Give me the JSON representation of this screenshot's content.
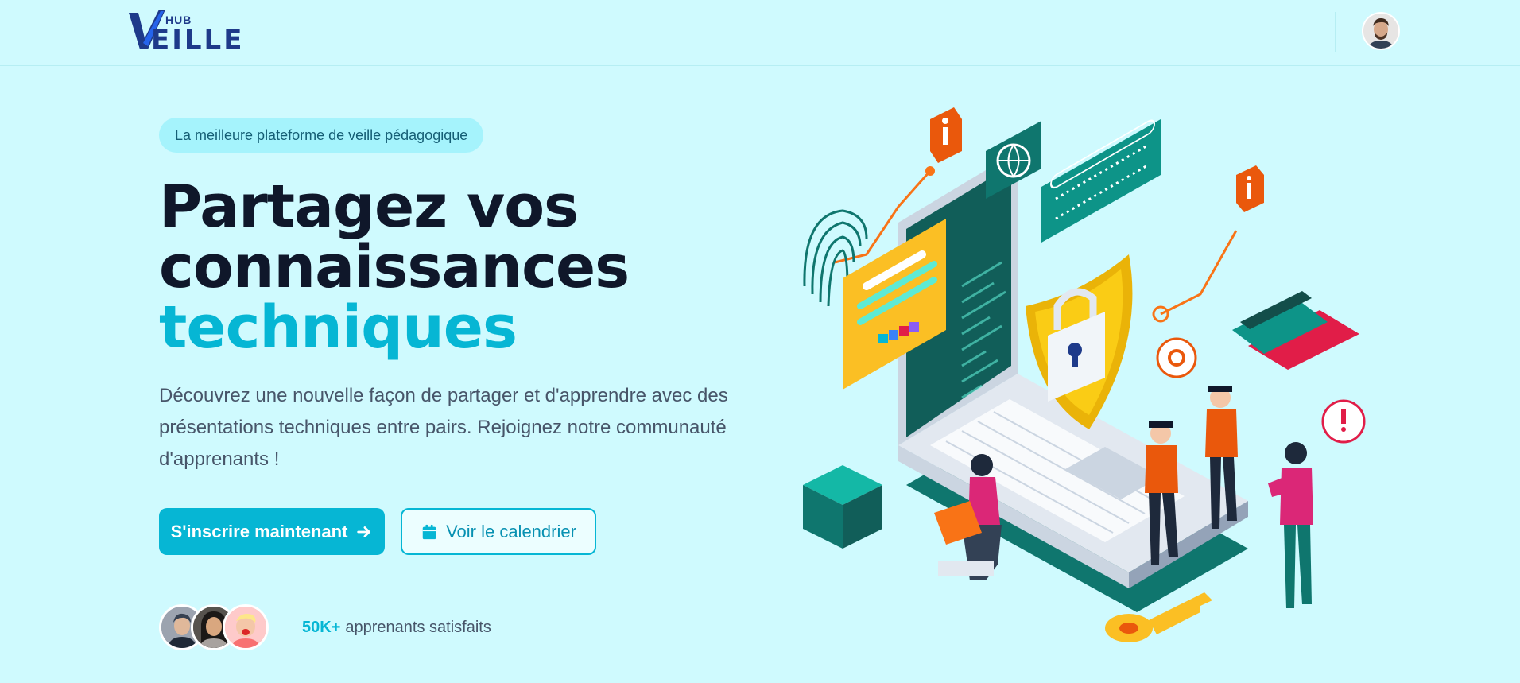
{
  "header": {
    "logo_small": "HUB",
    "logo_main": "EILLE",
    "user_avatar": "user-avatar"
  },
  "hero": {
    "badge": "La meilleure plateforme de veille pédagogique",
    "title_line1": "Partagez vos",
    "title_line2": "connaissances",
    "title_accent": "techniques",
    "description": "Découvrez une nouvelle façon de partager et d'apprendre avec des présentations techniques entre pairs. Rejoignez notre communauté d'apprenants !",
    "cta_primary": "S'inscrire maintenant",
    "cta_secondary": "Voir le calendrier",
    "social_count": "50K+",
    "social_text": "apprenants satisfaits"
  },
  "colors": {
    "background": "#cffafe",
    "accent": "#06b6d4",
    "brand": "#1e3a8a",
    "heading": "#0f172a"
  },
  "icons": {
    "primary_button": "arrow-right-icon",
    "secondary_button": "calendar-icon"
  }
}
